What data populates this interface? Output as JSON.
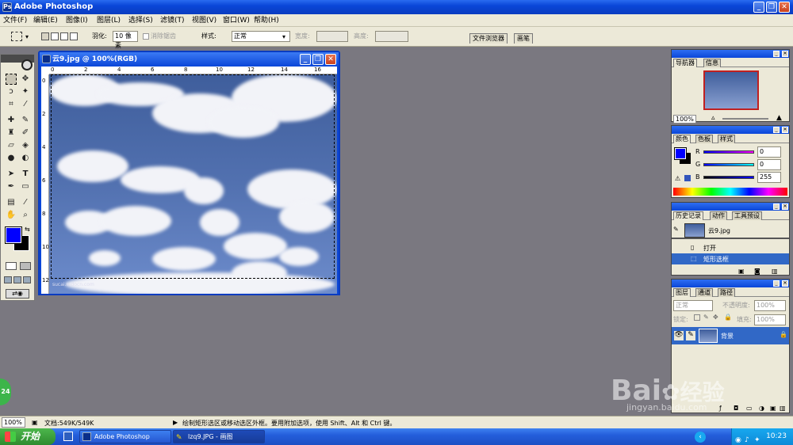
{
  "app": {
    "title": "Adobe Photoshop",
    "logo": "Ps"
  },
  "menu": [
    "文件(F)",
    "编辑(E)",
    "图像(I)",
    "图层(L)",
    "选择(S)",
    "滤镜(T)",
    "视图(V)",
    "窗口(W)",
    "帮助(H)"
  ],
  "options": {
    "feather_label": "羽化:",
    "feather_value": "10 像素",
    "antialias_label": "消除锯齿",
    "style_label": "样式:",
    "style_value": "正常",
    "width_label": "宽度:",
    "height_label": "高度:",
    "tabs": [
      "文件浏览器",
      "画笔"
    ]
  },
  "document": {
    "title": "云9.jpg @ 100%(RGB)",
    "ruler_h": [
      "0",
      "2",
      "4",
      "6",
      "8",
      "10",
      "12",
      "14",
      "16"
    ],
    "ruler_v": [
      "0",
      "2",
      "4",
      "6",
      "8",
      "10",
      "12"
    ],
    "watermark": "sucai.redocn.com"
  },
  "navigator": {
    "tabs": [
      "导航器",
      "信息"
    ],
    "zoom": "100%"
  },
  "color": {
    "tabs": [
      "颜色",
      "色板",
      "样式"
    ],
    "channels": [
      {
        "label": "R",
        "value": "0"
      },
      {
        "label": "G",
        "value": "0"
      },
      {
        "label": "B",
        "value": "255"
      }
    ],
    "foreground": "#0000ff",
    "background": "#000000"
  },
  "history": {
    "tabs": [
      "历史记录",
      "动作",
      "工具预设"
    ],
    "snapshot": "云9.jpg",
    "items": [
      "打开",
      "矩形选框"
    ]
  },
  "layers": {
    "tabs": [
      "图层",
      "通道",
      "路径"
    ],
    "blend_mode": "正常",
    "opacity_label": "不透明度:",
    "opacity_value": "100%",
    "lock_label": "锁定:",
    "fill_label": "填充:",
    "fill_value": "100%",
    "layer_name": "背景"
  },
  "status": {
    "zoom": "100%",
    "doc_size": "文档:549K/549K",
    "hint": "绘制矩形选区或移动选区外框。要用附加选项，使用 Shift、Alt 和 Ctrl 键。"
  },
  "taskbar": {
    "start": "开始",
    "tasks": [
      "Adobe Photoshop",
      "lzq9.JPG - 画图"
    ],
    "time": "10:23"
  },
  "overlay": {
    "badge": "24",
    "logo": "Bai",
    "logo2": "经验",
    "url": "jingyan.baidu.com"
  }
}
